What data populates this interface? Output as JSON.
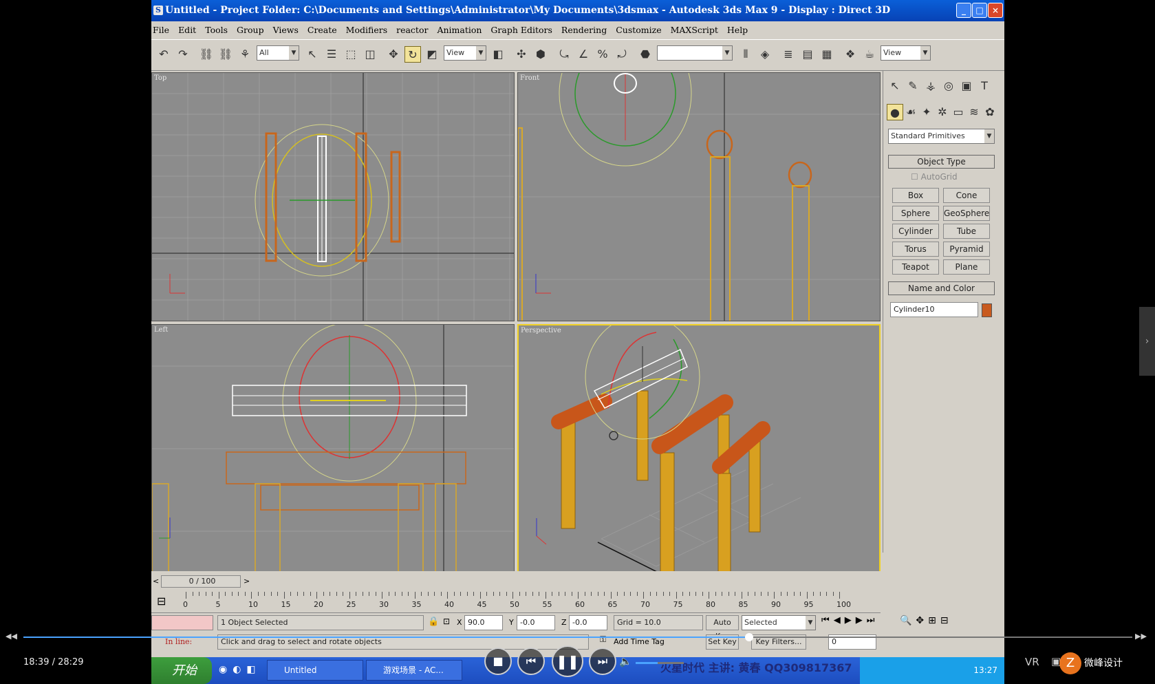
{
  "window": {
    "title": "Untitled    - Project Folder: C:\\Documents and Settings\\Administrator\\My Documents\\3dsmax    - Autodesk 3ds Max 9    - Display : Direct 3D",
    "app_icon": "3ds-max-icon",
    "controls": [
      "_",
      "□",
      "×"
    ]
  },
  "menu": [
    "File",
    "Edit",
    "Tools",
    "Group",
    "Views",
    "Create",
    "Modifiers",
    "reactor",
    "Animation",
    "Graph Editors",
    "Rendering",
    "Customize",
    "MAXScript",
    "Help"
  ],
  "toolbar": {
    "selection_filter": "All",
    "ref_coord": "View",
    "named_sel": "",
    "view_dropdown": "View"
  },
  "viewports": {
    "top": "Top",
    "front": "Front",
    "left": "Left",
    "perspective": "Perspective"
  },
  "command_panel": {
    "category": "Standard Primitives",
    "object_type_title": "Object Type",
    "autogrid": "AutoGrid",
    "buttons": [
      "Box",
      "Cone",
      "Sphere",
      "GeoSphere",
      "Cylinder",
      "Tube",
      "Torus",
      "Pyramid",
      "Teapot",
      "Plane"
    ],
    "name_color_title": "Name and Color",
    "object_name": "Cylinder10",
    "object_color": "#c85a1e"
  },
  "timeline": {
    "slider": "0 / 100",
    "ticks": [
      "0",
      "5",
      "10",
      "15",
      "20",
      "25",
      "30",
      "35",
      "40",
      "45",
      "50",
      "55",
      "60",
      "65",
      "70",
      "75",
      "80",
      "85",
      "90",
      "95",
      "100"
    ]
  },
  "status": {
    "selected": "1 Object Selected",
    "prompt": "Click and drag to select and rotate objects",
    "x_label": "X",
    "x": "90.0",
    "y_label": "Y",
    "y": "-0.0",
    "z_label": "Z",
    "z": "-0.0",
    "grid": "Grid = 10.0",
    "autokey": "Auto Key",
    "key_mode": "Selected",
    "setkey": "Set Key",
    "keyfilters": "Key Filters...",
    "frame": "0",
    "add_time_tag": "Add Time Tag",
    "inline": "In line:"
  },
  "taskbar": {
    "start": "开始",
    "tasks": [
      "Untitled",
      "游戏场景 - AC..."
    ],
    "overlay": "火星时代  主讲: 黄春  QQ309817367",
    "clock": "13:27"
  },
  "player": {
    "time": "18:39 / 28:29",
    "progress": 0.6547,
    "volume": 0.45,
    "vr": "VR",
    "logo_text": "微峰设计"
  }
}
